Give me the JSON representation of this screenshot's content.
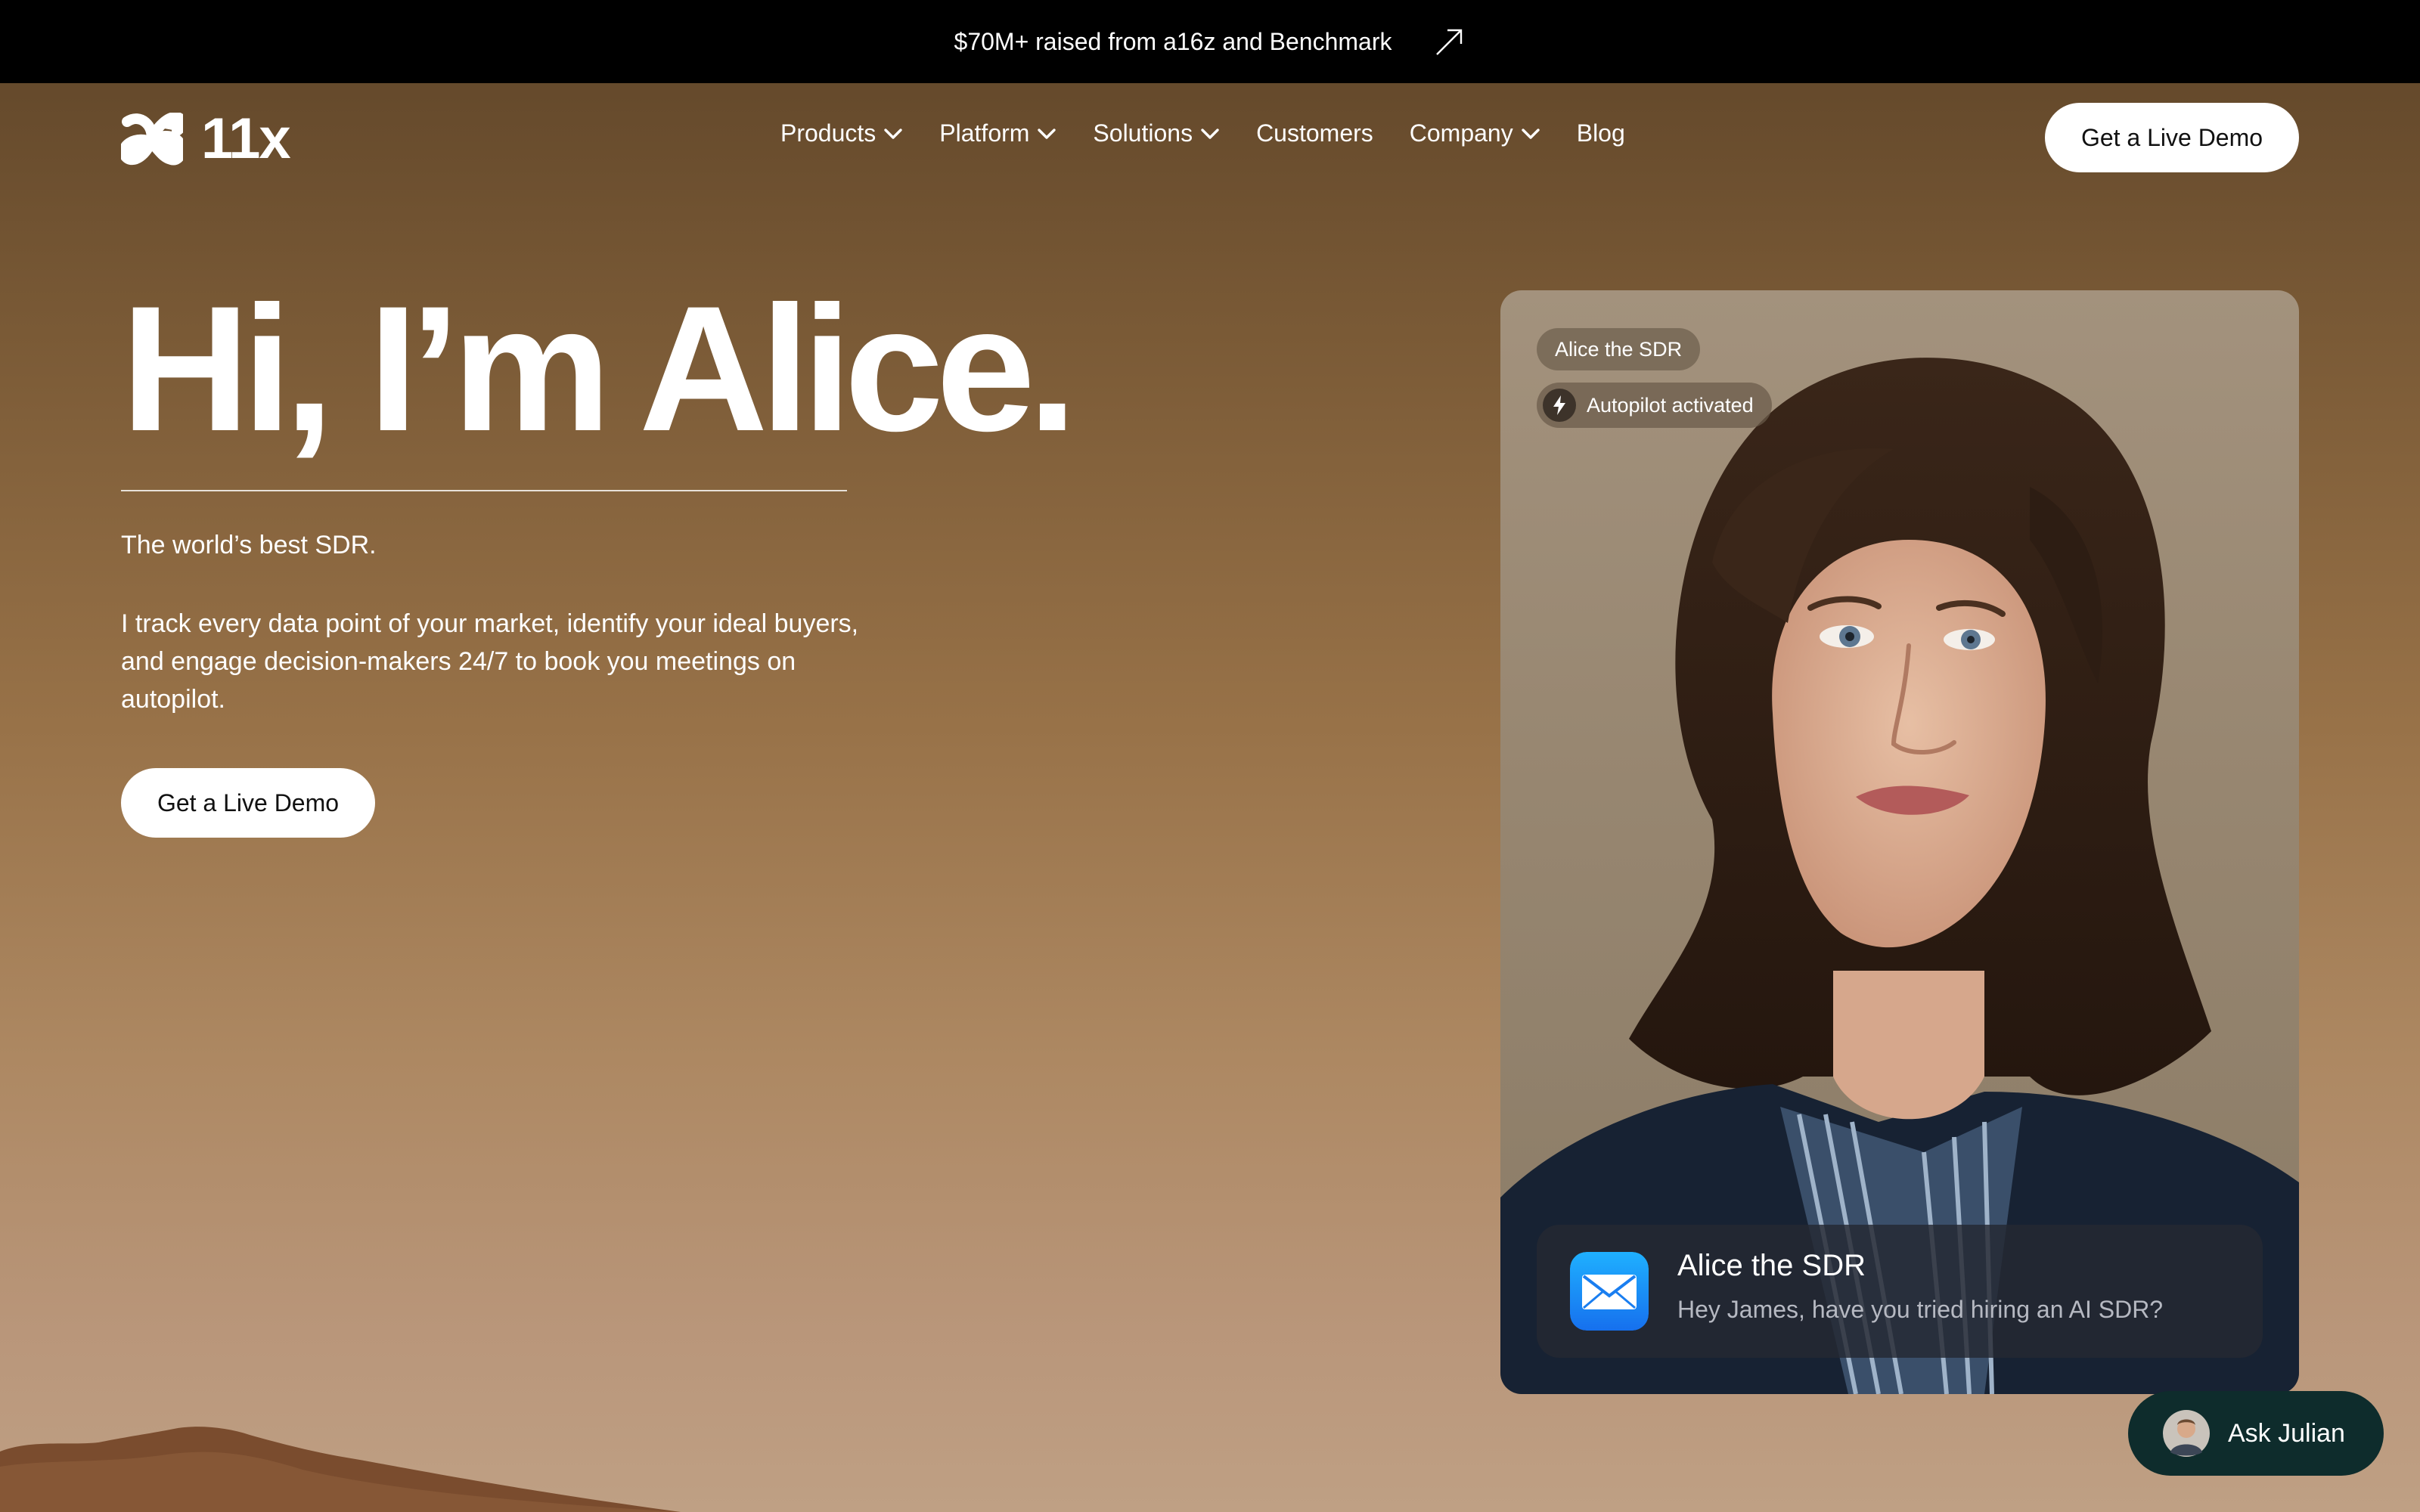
{
  "banner": {
    "text": "$70M+ raised from a16z and Benchmark",
    "icon": "arrow-up-right-icon"
  },
  "header": {
    "logo_text": "11x",
    "nav": [
      {
        "label": "Products",
        "has_dropdown": true
      },
      {
        "label": "Platform",
        "has_dropdown": true
      },
      {
        "label": "Solutions",
        "has_dropdown": true
      },
      {
        "label": "Customers",
        "has_dropdown": false
      },
      {
        "label": "Company",
        "has_dropdown": true
      },
      {
        "label": "Blog",
        "has_dropdown": false
      }
    ],
    "cta_label": "Get a Live Demo"
  },
  "hero": {
    "title": "Hi, I’m Alice.",
    "subtitle": "The world’s best SDR.",
    "description": "I track every data point of your market, identify your ideal buyers, and engage decision-makers 24/7 to book you meetings on autopilot.",
    "cta_label": "Get a Live Demo"
  },
  "card": {
    "tag": "Alice the SDR",
    "status": "Autopilot activated",
    "status_icon": "lightning-bolt-icon",
    "notification": {
      "icon": "mail-app-icon",
      "title": "Alice the SDR",
      "message": "Hey James, have you tried hiring an AI SDR?"
    }
  },
  "chat": {
    "label": "Ask Julian"
  },
  "colors": {
    "banner_bg": "#000000",
    "button_bg": "#ffffff",
    "chat_bg": "#0e2c2c",
    "mail_icon_blue": "#1a8cff"
  }
}
